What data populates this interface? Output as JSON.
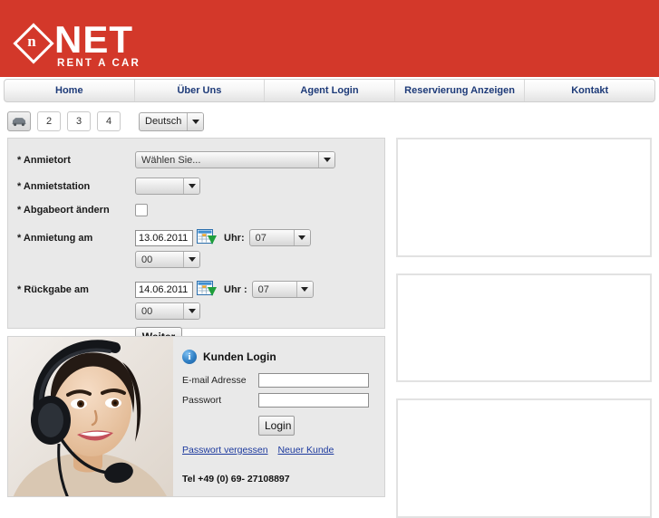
{
  "brand": {
    "logo_mark": "diamond-n",
    "logo_letter": "n",
    "name": "NET",
    "tagline": "RENT A CAR",
    "header_color": "#d3382a"
  },
  "nav": {
    "items": [
      {
        "label": "Home",
        "name": "nav-home"
      },
      {
        "label": "Über Uns",
        "name": "nav-ueber-uns"
      },
      {
        "label": "Agent Login",
        "name": "nav-agent-login"
      },
      {
        "label": "Reservierung Anzeigen",
        "name": "nav-reservierung-anzeigen"
      },
      {
        "label": "Kontakt",
        "name": "nav-kontakt"
      }
    ]
  },
  "steps": {
    "step1_icon": "car-icon",
    "items": [
      "2",
      "3",
      "4"
    ]
  },
  "language": {
    "selected": "Deutsch"
  },
  "booking": {
    "fields": {
      "anmietort": {
        "label": "* Anmietort",
        "value": "Wählen Sie..."
      },
      "anmietstation": {
        "label": "* Anmietstation",
        "value": ""
      },
      "abgabeort": {
        "label": "* Abgabeort ändern",
        "checked": false
      },
      "anmietung": {
        "label": "* Anmietung am",
        "date": "13.06.2011",
        "uhr_label": "Uhr:",
        "hour": "07",
        "minute": "00",
        "calendar_icon": "calendar-icon"
      },
      "rueckgabe": {
        "label": "* Rückgabe am",
        "date": "14.06.2011",
        "uhr_label": "Uhr :",
        "hour": "07",
        "minute": "00",
        "calendar_icon": "calendar-icon"
      }
    },
    "submit_label": "Weiter"
  },
  "login": {
    "title": "Kunden Login",
    "info_icon": "info-icon",
    "email_label": "E-mail Adresse",
    "email_value": "",
    "password_label": "Passwort",
    "password_value": "",
    "button_label": "Login",
    "link_forgot": "Passwort vergessen",
    "link_new": "Neuer Kunde",
    "phone": "Tel +49 (0) 69- 27108897",
    "photo_alt": "call-center-agent-photo"
  },
  "side_panels": [
    {
      "name": "side-panel-1",
      "content": ""
    },
    {
      "name": "side-panel-2",
      "content": ""
    },
    {
      "name": "side-panel-3",
      "content": ""
    }
  ]
}
